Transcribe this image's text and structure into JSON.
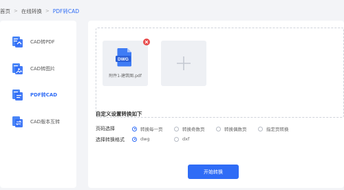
{
  "breadcrumb": {
    "home": "首页",
    "section": "在线转换",
    "current": "PDF转CAD"
  },
  "sidebar": {
    "items": [
      {
        "label": "CAD转PDF",
        "icon": "cad-to-pdf-icon"
      },
      {
        "label": "CAD转图片",
        "icon": "cad-to-image-icon"
      },
      {
        "label": "PDF转CAD",
        "icon": "pdf-to-cad-icon",
        "active": true
      },
      {
        "label": "CAD版本互转",
        "icon": "cad-version-icon"
      }
    ]
  },
  "upload": {
    "file_name": "附件1-建筑图.pdf",
    "file_badge": "DWG",
    "add_icon": "plus-icon",
    "remove_icon": "close-icon"
  },
  "settings": {
    "title": "自定义设置转换如下",
    "page_select": {
      "label": "页码选择",
      "options": [
        "转换每一页",
        "转换奇数页",
        "转换偶数页",
        "指定页转换"
      ],
      "selected": 0
    },
    "format_select": {
      "label": "选择转换格式",
      "options": [
        "dwg",
        "dxf"
      ],
      "selected": 0
    }
  },
  "actions": {
    "start_label": "开始转换"
  },
  "colors": {
    "accent": "#2f6cf6",
    "delete": "#e84c4c",
    "background": "#f3f4f7"
  }
}
